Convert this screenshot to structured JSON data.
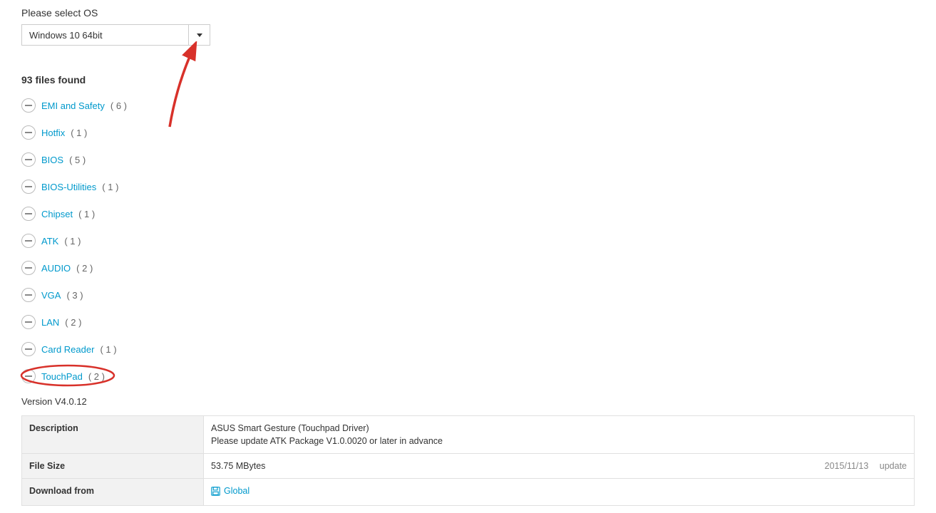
{
  "os_section": {
    "label": "Please select OS",
    "selected": "Windows 10 64bit"
  },
  "files_found": "93 files found",
  "categories": [
    {
      "name": "EMI and Safety",
      "count": "( 6 )",
      "highlighted": false
    },
    {
      "name": "Hotfix",
      "count": "( 1 )",
      "highlighted": false
    },
    {
      "name": "BIOS",
      "count": "( 5 )",
      "highlighted": false
    },
    {
      "name": "BIOS-Utilities",
      "count": "( 1 )",
      "highlighted": false
    },
    {
      "name": "Chipset",
      "count": "( 1 )",
      "highlighted": false
    },
    {
      "name": "ATK",
      "count": "( 1 )",
      "highlighted": false
    },
    {
      "name": "AUDIO",
      "count": "( 2 )",
      "highlighted": false
    },
    {
      "name": "VGA",
      "count": "( 3 )",
      "highlighted": false
    },
    {
      "name": "LAN",
      "count": "( 2 )",
      "highlighted": false
    },
    {
      "name": "Card Reader",
      "count": "( 1 )",
      "highlighted": false
    },
    {
      "name": "TouchPad",
      "count": "( 2 )",
      "highlighted": true
    }
  ],
  "expanded": {
    "version": "Version V4.0.12",
    "rows": {
      "description": {
        "label": "Description",
        "line1": "ASUS Smart Gesture (Touchpad Driver)",
        "line2": "Please update ATK Package V1.0.0020 or later in advance"
      },
      "filesize": {
        "label": "File Size",
        "value": "53.75 MBytes",
        "date": "2015/11/13",
        "update": "update"
      },
      "download": {
        "label": "Download from",
        "link": "Global"
      }
    }
  }
}
